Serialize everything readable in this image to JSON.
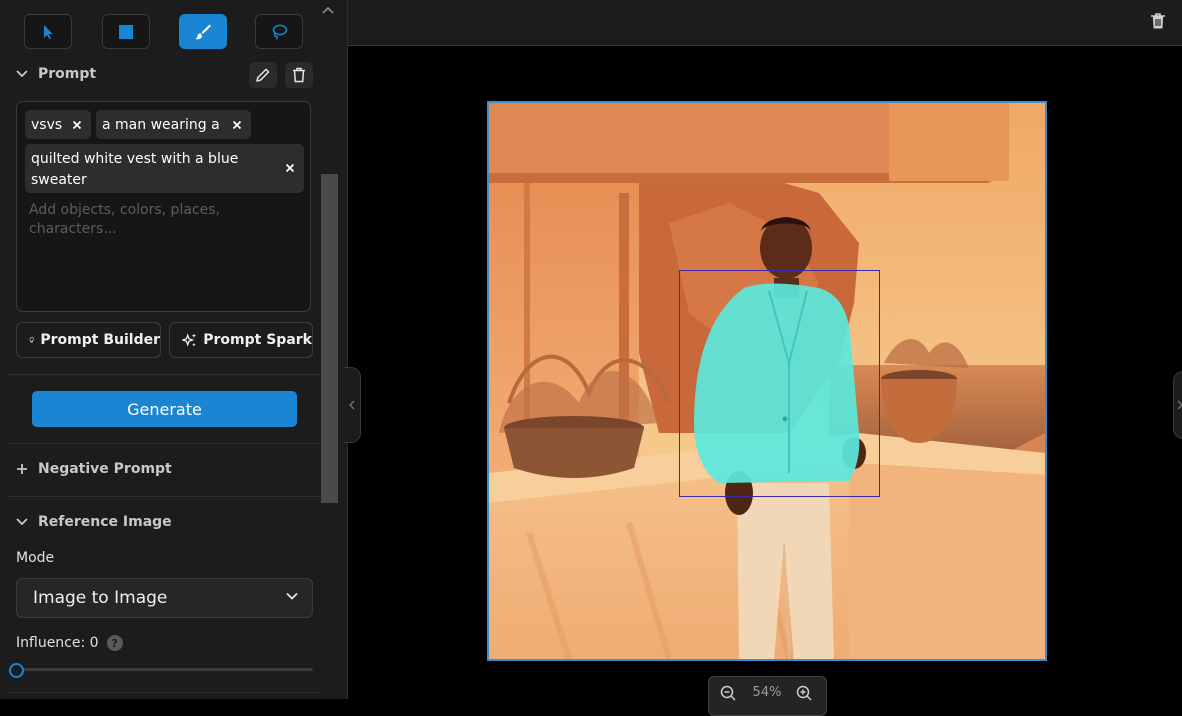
{
  "toolbar": {
    "tools": [
      {
        "name": "select",
        "icon": "cursor-arrow-icon",
        "active": false
      },
      {
        "name": "rectangle",
        "icon": "square-icon",
        "active": false
      },
      {
        "name": "brush",
        "icon": "brush-icon",
        "active": true
      },
      {
        "name": "lasso",
        "icon": "lasso-icon",
        "active": false
      }
    ]
  },
  "prompt": {
    "title": "Prompt",
    "chips": [
      "vsvs",
      "a man wearing a",
      "quilted white vest with a blue sweater"
    ],
    "placeholder": "Add objects, colors, places, characters...",
    "builder_label": "Prompt Builder",
    "spark_label": "Prompt Spark"
  },
  "generate_label": "Generate",
  "negative_prompt": {
    "title": "Negative Prompt"
  },
  "reference_image": {
    "title": "Reference Image",
    "mode_label": "Mode",
    "mode_value": "Image to Image",
    "influence_label": "Influence: 0",
    "influence_value": 0
  },
  "canvas": {
    "zoom": "54%"
  },
  "colors": {
    "accent": "#1a86d3",
    "panel": "#1c1c1c",
    "mask": "#5be8dc",
    "selection": "#3d2aa8"
  }
}
